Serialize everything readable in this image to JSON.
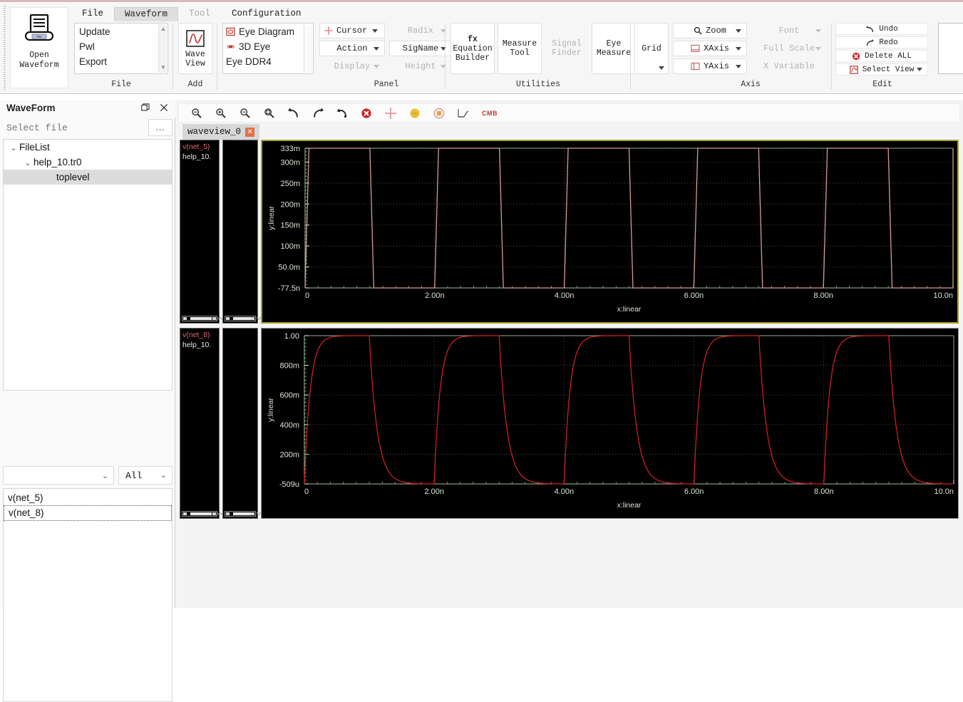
{
  "app": {
    "open_button": {
      "label_line1": "Open",
      "label_line2": "Waveform",
      "icon_badge": "File"
    }
  },
  "tabs": [
    {
      "label": "File",
      "active": false,
      "disabled": false
    },
    {
      "label": "Waveform",
      "active": true,
      "disabled": false
    },
    {
      "label": "Tool",
      "active": false,
      "disabled": true
    },
    {
      "label": "Configuration",
      "active": false,
      "disabled": false
    }
  ],
  "ribbon": {
    "groups": [
      {
        "name": "File",
        "label": "File"
      },
      {
        "name": "Add",
        "label": "Add"
      },
      {
        "name": "Panel",
        "label": "Panel"
      },
      {
        "name": "Utilities",
        "label": "Utilities"
      },
      {
        "name": "Axis",
        "label": "Axis"
      },
      {
        "name": "Edit",
        "label": "Edit"
      }
    ],
    "file_list": [
      "Update",
      "Pwl",
      "Export"
    ],
    "wave_view": {
      "line1": "Wave",
      "line2": "View"
    },
    "panel_items": [
      "Eye Diagram",
      "3D Eye",
      "Eye DDR4"
    ],
    "panel_controls": [
      {
        "label": "Cursor",
        "disabled": false,
        "caret": true,
        "icon": "cursor-cross-icon"
      },
      {
        "label": "Radix",
        "disabled": true,
        "caret": true
      },
      {
        "label": "Action",
        "disabled": false,
        "caret": true
      },
      {
        "label": "SigName",
        "disabled": false,
        "caret": true
      },
      {
        "label": "Display",
        "disabled": true,
        "caret": true
      },
      {
        "label": "Height",
        "disabled": true,
        "caret": true
      }
    ],
    "utilities": [
      {
        "line1": "fx",
        "line2": "Equation",
        "line3": "Builder",
        "disabled": false
      },
      {
        "line1": "Measure",
        "line2": "Tool",
        "disabled": false
      },
      {
        "line1": "Signal",
        "line2": "Finder",
        "disabled": true
      },
      {
        "line1": "Eye",
        "line2": "Measure",
        "disabled": false
      }
    ],
    "grid_button": {
      "label": "Grid"
    },
    "axis_controls": [
      {
        "label": "Zoom",
        "disabled": false,
        "caret": true,
        "icon": "magnifier-icon"
      },
      {
        "label": "Font",
        "disabled": true,
        "caret": true
      },
      {
        "label": "XAxis",
        "disabled": false,
        "caret": true,
        "icon": "xaxis-icon"
      },
      {
        "label": "Full Scale",
        "disabled": true,
        "caret": true
      },
      {
        "label": "YAxis",
        "disabled": false,
        "caret": true,
        "icon": "yaxis-icon"
      },
      {
        "label": "X Variable",
        "disabled": true,
        "caret": false
      }
    ],
    "edit_controls": [
      {
        "label": "Undo",
        "icon": "undo-icon"
      },
      {
        "label": "Redo",
        "icon": "redo-icon"
      },
      {
        "label": "Delete ALL",
        "icon": "delete-icon"
      },
      {
        "label": "Select View",
        "icon": "select-view-icon",
        "caret": true
      }
    ]
  },
  "dock": {
    "title": "WaveForm",
    "float_icon": "float-window-icon",
    "close_icon": "close-icon",
    "file_select_placeholder": "Select file",
    "file_select_value": "",
    "browse_label": "...",
    "tree": [
      {
        "label": "FileList",
        "depth": 0,
        "expanded": true,
        "selected": false
      },
      {
        "label": "help_10.tr0",
        "depth": 1,
        "expanded": true,
        "selected": false
      },
      {
        "label": "toplevel",
        "depth": 2,
        "expanded": null,
        "selected": true
      }
    ],
    "filter_value": "",
    "scope_value": "All",
    "signals": [
      {
        "label": "v(net_5)",
        "focused": false
      },
      {
        "label": "v(net_8)",
        "focused": true
      }
    ]
  },
  "wave": {
    "toolbar_icons": [
      "zoom-fit-icon",
      "zoom-in-icon",
      "zoom-out-icon",
      "zoom-area-icon",
      "undo-icon",
      "redo-icon",
      "reset-icon",
      "delete-icon",
      "cursor-cross-icon",
      "marker-yellow-icon",
      "marker-ring-icon",
      "slope-icon",
      "cmb-icon"
    ],
    "tab_label": "waveview_0",
    "tab_close": "close-icon",
    "panes": [
      {
        "signal_name": "v(net_5)",
        "signal_file": "help_10.",
        "selected": true
      },
      {
        "signal_name": "v(net_8)",
        "signal_file": "help_10.",
        "selected": false
      }
    ]
  },
  "chart_data": [
    {
      "type": "line",
      "title": "",
      "xlabel": "x:linear",
      "ylabel": "y:linear",
      "xticks": [
        "0",
        "2.00n",
        "4.00n",
        "6.00n",
        "8.00n",
        "10.0n"
      ],
      "xtickvals": [
        0,
        2,
        4,
        6,
        8,
        10
      ],
      "yticks": [
        "-77.5n",
        "50.0m",
        "100m",
        "150m",
        "200m",
        "250m",
        "300m",
        "333m"
      ],
      "ytickvals": [
        0,
        0.05,
        0.1,
        0.15,
        0.2,
        0.25,
        0.3,
        0.333
      ],
      "xlim": [
        0,
        10
      ],
      "ylim": [
        0,
        0.333
      ],
      "grid": true,
      "series": [
        {
          "name": "v(net_5)",
          "color": "#d99a9a",
          "waveform": "square",
          "period_ns": 2.0,
          "duty": 0.5,
          "rise_ns": 0.06,
          "fall_ns": 0.06,
          "low": 0,
          "high": 0.333,
          "start_state": "rising_at_0"
        }
      ]
    },
    {
      "type": "line",
      "title": "",
      "xlabel": "x:linear",
      "ylabel": "y:linear",
      "xticks": [
        "0",
        "2.00n",
        "4.00n",
        "6.00n",
        "8.00n",
        "10.0n"
      ],
      "xtickvals": [
        0,
        2,
        4,
        6,
        8,
        10
      ],
      "yticks": [
        "-509u",
        "200m",
        "400m",
        "600m",
        "800m",
        "1.00"
      ],
      "ytickvals": [
        0,
        0.2,
        0.4,
        0.6,
        0.8,
        1.0
      ],
      "xlim": [
        0,
        10
      ],
      "ylim": [
        0,
        1.0
      ],
      "grid": true,
      "series": [
        {
          "name": "v(net_8)",
          "color": "#cc1f1f",
          "waveform": "rc-square",
          "period_ns": 2.0,
          "duty": 0.5,
          "tau_rise_ns": 0.09,
          "tau_fall_ns": 0.12,
          "low": 0,
          "high": 1.0,
          "start_state": "rising_at_0"
        }
      ]
    }
  ]
}
